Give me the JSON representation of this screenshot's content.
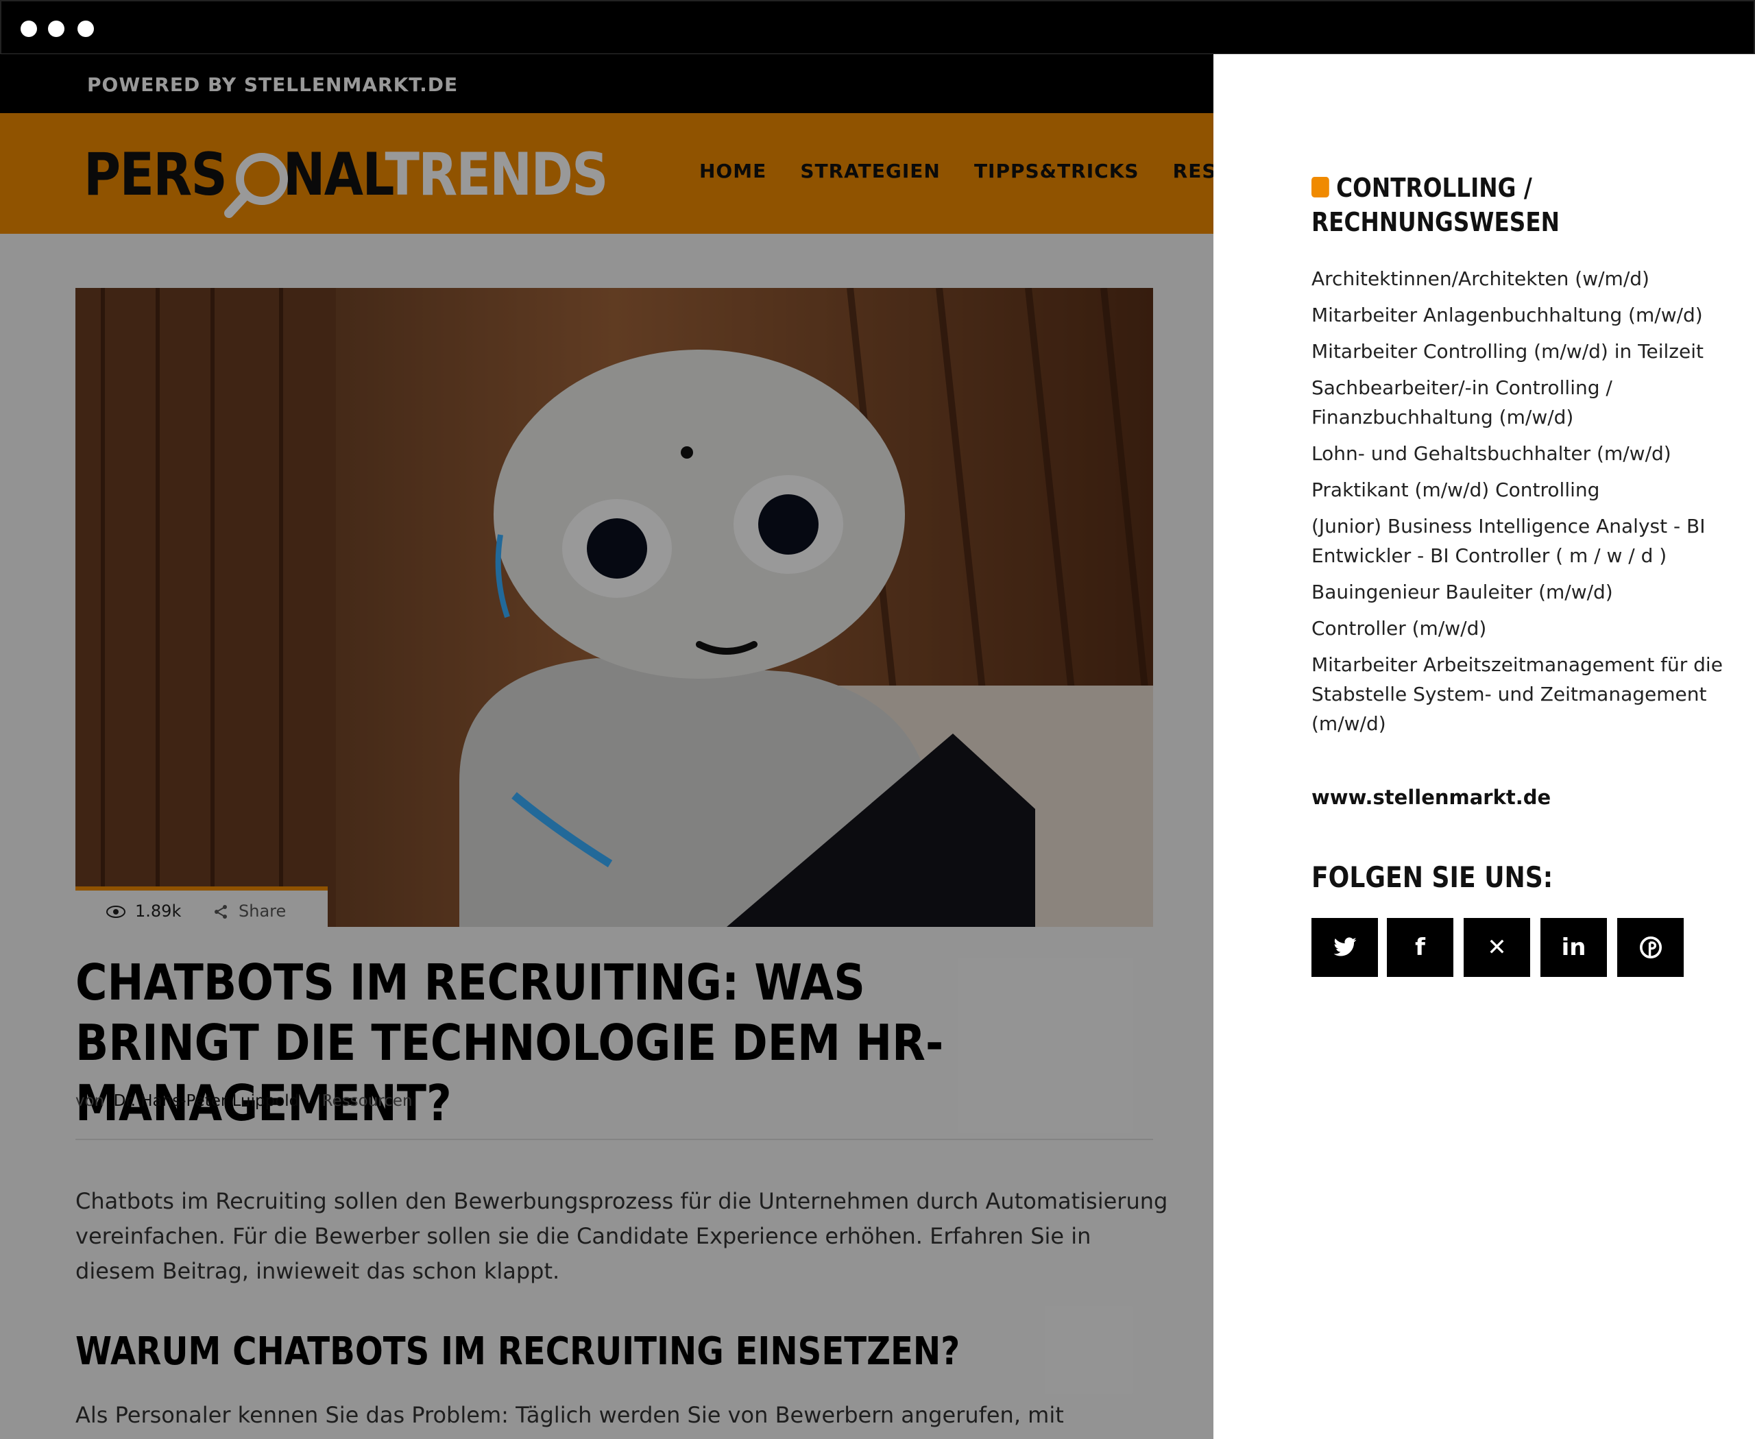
{
  "site": {
    "powered_by": "POWERED BY STELLENMARKT.DE",
    "logo_part1": "PERS",
    "logo_part2": "NAL",
    "logo_part3": "TRENDS",
    "nav": [
      "HOME",
      "STRATEGIEN",
      "TIPPS&TRICKS",
      "RESSOU"
    ]
  },
  "article": {
    "views": "1.89k",
    "share_label": "Share",
    "title": "CHATBOTS IM RECRUITING: WAS BRINGT DIE TECHNOLOGIE DEM HR-MANAGEMENT?",
    "byline_prefix": "von",
    "author": "Dr. Hans-Peter Luippold",
    "category": "Ressourcen",
    "intro": "Chatbots im Recruiting sollen den Bewerbungsprozess für die Unternehmen durch Automatisierung vereinfachen. Für die Bewerber sollen sie die Candidate Experience erhöhen. Erfahren Sie in diesem Beitrag, inwieweit das schon klappt.",
    "subheading": "WARUM CHATBOTS IM RECRUITING EINSETZEN?",
    "body_start": "Als Personaler kennen Sie das Problem: Täglich werden Sie von Bewerbern angerufen, mit"
  },
  "sidebar": {
    "widget_title": "CONTROLLING / RECHNUNGSWESEN",
    "jobs": [
      "Architektinnen/Architekten (w/m/d)",
      "Mitarbeiter Anlagenbuchhaltung (m/w/d)",
      "Mitarbeiter Controlling (m/w/d) in Teilzeit",
      "Sachbearbeiter/-in Controlling / Finanzbuchhaltung (m/w/d)",
      "Lohn- und Gehaltsbuchhalter (m/w/d)",
      "Praktikant (m/w/d) Controlling",
      "(Junior) Business Intelligence Analyst - BI Entwickler - BI Controller ( m / w / d )",
      "Bauingenieur Bauleiter (m/w/d)",
      "Controller (m/w/d)",
      "Mitarbeiter Arbeitszeitmanagement für die Stabstelle System- und Zeitmanagement (m/w/d)"
    ],
    "site_link": "www.stellenmarkt.de",
    "follow_title": "FOLGEN SIE UNS:",
    "socials": [
      {
        "icon": "twitter-icon",
        "glyph": "🐦"
      },
      {
        "icon": "facebook-icon",
        "glyph": "f"
      },
      {
        "icon": "xing-icon",
        "glyph": "✕"
      },
      {
        "icon": "linkedin-icon",
        "glyph": "in"
      },
      {
        "icon": "pinterest-icon",
        "glyph": "P"
      }
    ]
  }
}
